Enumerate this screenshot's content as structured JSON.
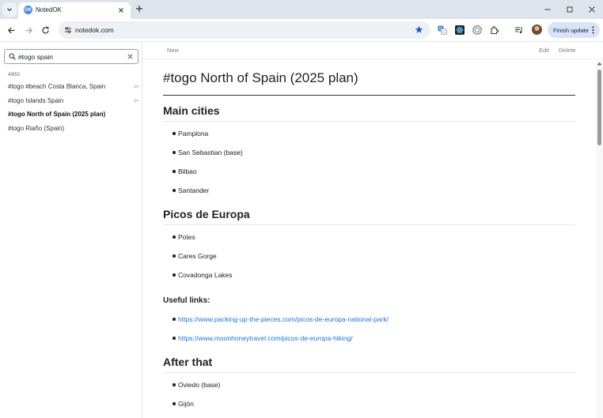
{
  "browser": {
    "tab_title": "NotedOK",
    "favicon_text": "OK",
    "url": "notedok.com",
    "finish_update_label": "Finish update"
  },
  "sidebar": {
    "search_value": "#togo spain",
    "result_count": "4/853",
    "notes": [
      {
        "title": "#togo #beach Costa Blanca, Spain",
        "ext": "txt",
        "active": false
      },
      {
        "title": "#togo Islands Spain",
        "ext": "txt",
        "active": false
      },
      {
        "title": "#togo North of Spain (2025 plan)",
        "ext": "",
        "active": true
      },
      {
        "title": "#togo Riaño (Spain)",
        "ext": "",
        "active": false
      }
    ]
  },
  "toolbar": {
    "new_label": "New",
    "edit_label": "Edit",
    "delete_label": "Delete"
  },
  "note": {
    "title": "#togo North of Spain (2025 plan)",
    "section1": {
      "heading": "Main cities",
      "items": [
        "Pamplona",
        "San Sebastian (base)",
        "Bilbao",
        "Santander"
      ]
    },
    "section2": {
      "heading": "Picos de Europa",
      "items": [
        "Potes",
        "Cares Gorge",
        "Covadonga Lakes"
      ]
    },
    "useful": {
      "heading": "Useful links:",
      "links": [
        "https://www.packing-up-the-pieces.com/picos-de-europa-national-park/",
        "https://www.moonhoneytravel.com/picos-de-europa-hiking/"
      ]
    },
    "section3": {
      "heading": "After that",
      "items": [
        "Oviedo (base)",
        "Gijón"
      ]
    }
  },
  "colors": {
    "accent": "#1a73e8",
    "chrome_bg": "#dfe3eb",
    "update_pill": "#d8e4fb"
  }
}
